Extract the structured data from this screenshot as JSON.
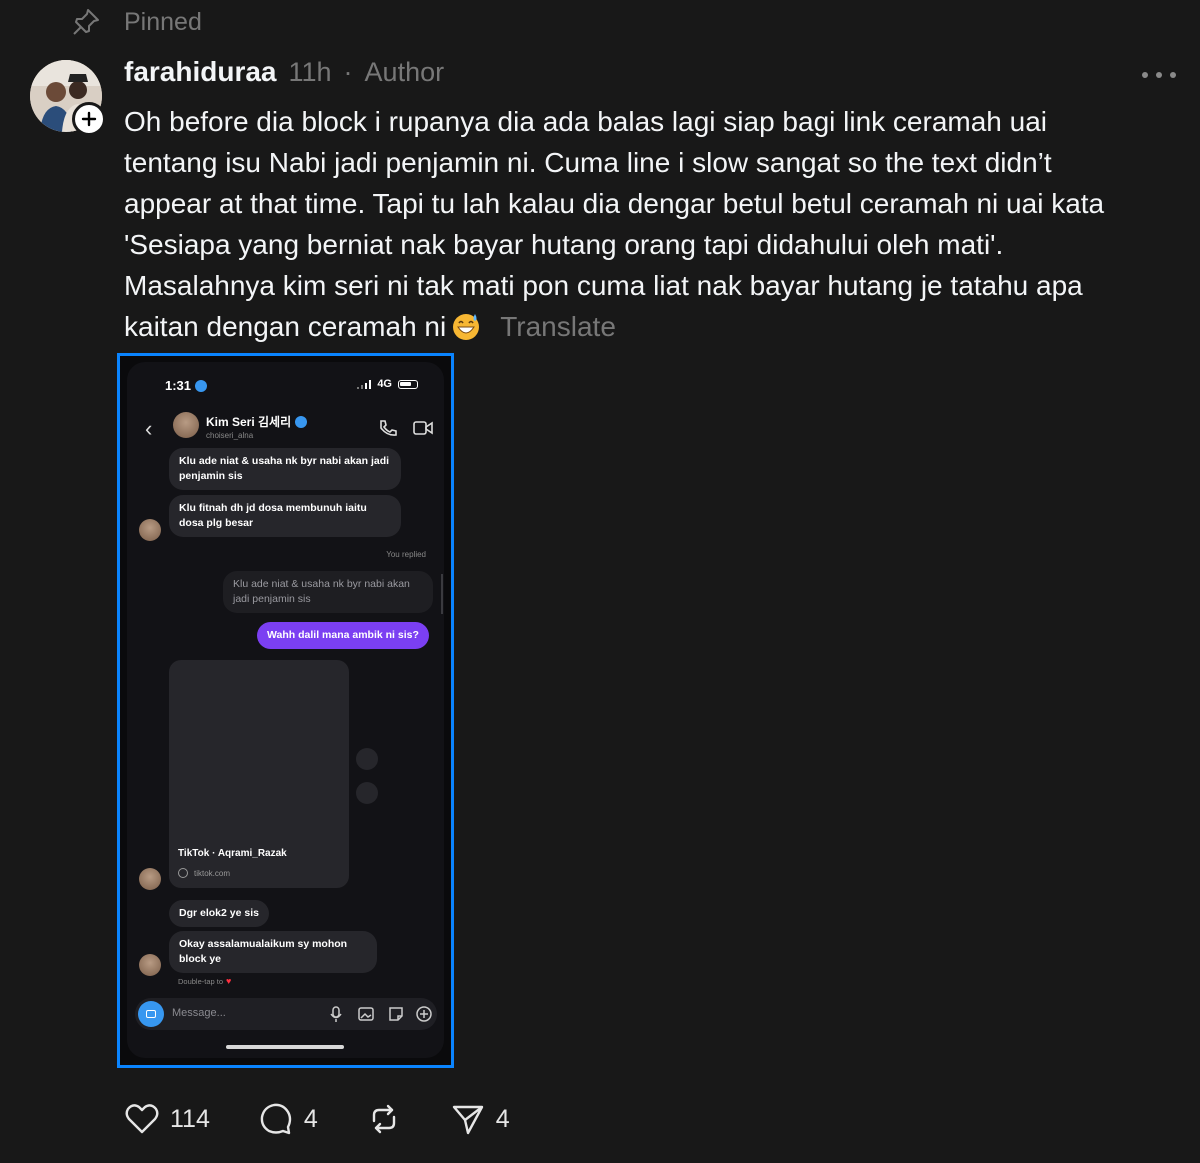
{
  "pinned": {
    "label": "Pinned"
  },
  "post": {
    "username": "farahiduraa",
    "time": "11h",
    "separator": "·",
    "author_badge": "Author",
    "text_lines": [
      "Oh before dia block i rupanya dia ada balas lagi siap bagi link ceramah uai",
      "tentang isu Nabi jadi penjamin ni. Cuma line i slow sangat so the text didn’t",
      "appear at that time. Tapi tu lah kalau dia dengar betul betul ceramah ni uai kata",
      "'Sesiapa yang berniat nak bayar hutang orang tapi didahului oleh mati'.",
      "Masalahnya kim seri ni tak mati pon cuma liat nak bayar hutang je tatahu apa",
      "kaitan dengan ceramah ni"
    ],
    "emoji": "grinning-sweat-emoji",
    "translate_label": "Translate"
  },
  "screenshot": {
    "status_time": "1:31",
    "network": "4G",
    "contact_name": "Kim Seri 김세리",
    "contact_handle": "choiseri_alna",
    "messages": [
      {
        "text": "Klu ade niat & usaha nk byr nabi akan jadi penjamin sis"
      },
      {
        "text": "Klu fitnah dh jd dosa membunuh iaitu dosa plg besar"
      }
    ],
    "you_replied": "You replied",
    "quoted_reply": "Klu ade niat & usaha nk byr nabi akan jadi penjamin sis",
    "my_message": "Wahh dalil mana ambik ni sis?",
    "link_title": "TikTok · Aqrami_Razak",
    "link_domain": "tiktok.com",
    "later_messages": [
      {
        "text": "Dgr elok2 ye sis"
      },
      {
        "text": "Okay assalamualaikum sy mohon block ye"
      }
    ],
    "double_tap": "Double-tap to",
    "composer_placeholder": "Message..."
  },
  "actions": {
    "likes": "114",
    "replies": "4",
    "shares": "4"
  },
  "colors": {
    "background": "#181818",
    "accent_frame": "#0a84ff",
    "my_bubble": "#7b3ff2"
  }
}
